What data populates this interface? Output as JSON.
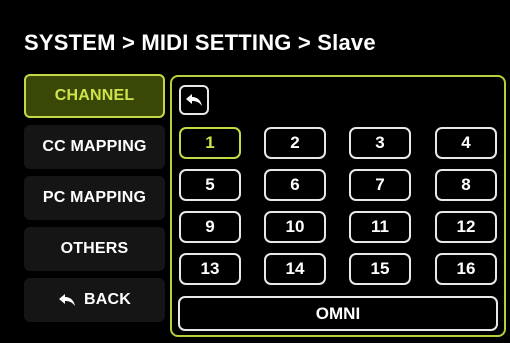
{
  "header": {
    "breadcrumb": "SYSTEM  >  MIDI SETTING > Slave"
  },
  "sidebar": {
    "items": [
      {
        "label": "CHANNEL",
        "active": true
      },
      {
        "label": "CC MAPPING"
      },
      {
        "label": "PC MAPPING"
      },
      {
        "label": "OTHERS"
      }
    ],
    "back_label": "BACK"
  },
  "channels": {
    "buttons": [
      "1",
      "2",
      "3",
      "4",
      "5",
      "6",
      "7",
      "8",
      "9",
      "10",
      "11",
      "12",
      "13",
      "14",
      "15",
      "16"
    ],
    "selected": "1",
    "omni_label": "OMNI"
  },
  "colors": {
    "accent": "#c5d845",
    "active_bg": "#3a4807",
    "background": "#000000"
  },
  "icons": {
    "back": "back-arrow-icon",
    "undo": "undo-arrow-icon"
  }
}
